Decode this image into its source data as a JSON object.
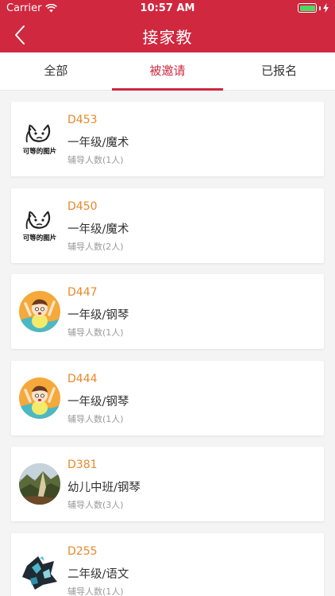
{
  "status": {
    "carrier": "Carrier",
    "time": "10:57 AM"
  },
  "header": {
    "title": "接家教"
  },
  "tabs": [
    {
      "label": "全部"
    },
    {
      "label": "被邀请",
      "active": true
    },
    {
      "label": "已报名"
    }
  ],
  "cards": [
    {
      "code": "D453",
      "subject": "一年级/魔术",
      "count": "辅导人数(1人)",
      "avatar": "meme-avatar",
      "avatar_caption": "可等的图片"
    },
    {
      "code": "D450",
      "subject": "一年级/魔术",
      "count": "辅导人数(2人)",
      "avatar": "meme-avatar",
      "avatar_caption": "可等的图片"
    },
    {
      "code": "D447",
      "subject": "一年级/钢琴",
      "count": "辅导人数(1人)",
      "avatar": "cartoon-avatar"
    },
    {
      "code": "D444",
      "subject": "一年级/钢琴",
      "count": "辅导人数(1人)",
      "avatar": "cartoon-avatar"
    },
    {
      "code": "D381",
      "subject": "幼儿中班/钢琴",
      "count": "辅导人数(3人)",
      "avatar": "landscape-avatar"
    },
    {
      "code": "D255",
      "subject": "二年级/语文",
      "count": "辅导人数(1人)",
      "avatar": "camo-avatar"
    }
  ],
  "colors": {
    "brand": "#d0283f",
    "code": "#e8892a",
    "muted": "#9a9a9a"
  }
}
